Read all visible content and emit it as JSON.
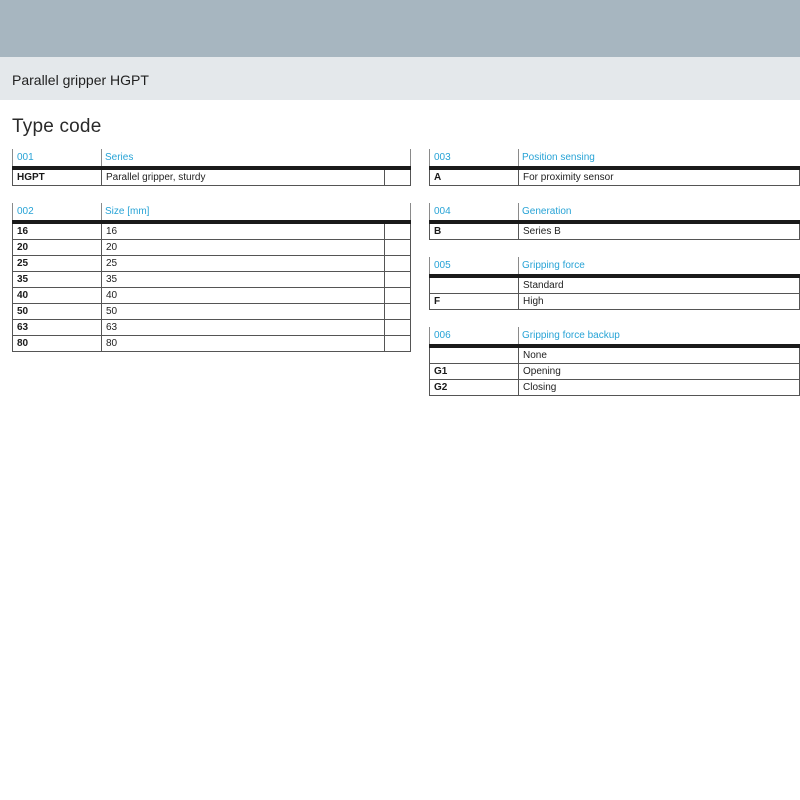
{
  "header": {
    "title": "Parallel gripper HGPT"
  },
  "page": {
    "heading": "Type code"
  },
  "tables": {
    "series": {
      "num": "001",
      "label": "Series",
      "rows": [
        {
          "code": "HGPT",
          "desc": "Parallel gripper, sturdy"
        }
      ]
    },
    "size": {
      "num": "002",
      "label": "Size [mm]",
      "rows": [
        {
          "code": "16",
          "desc": "16"
        },
        {
          "code": "20",
          "desc": "20"
        },
        {
          "code": "25",
          "desc": "25"
        },
        {
          "code": "35",
          "desc": "35"
        },
        {
          "code": "40",
          "desc": "40"
        },
        {
          "code": "50",
          "desc": "50"
        },
        {
          "code": "63",
          "desc": "63"
        },
        {
          "code": "80",
          "desc": "80"
        }
      ]
    },
    "position_sensing": {
      "num": "003",
      "label": "Position sensing",
      "rows": [
        {
          "code": "A",
          "desc": "For proximity sensor"
        }
      ]
    },
    "generation": {
      "num": "004",
      "label": "Generation",
      "rows": [
        {
          "code": "B",
          "desc": "Series B"
        }
      ]
    },
    "gripping_force": {
      "num": "005",
      "label": "Gripping force",
      "rows": [
        {
          "code": "",
          "desc": "Standard"
        },
        {
          "code": "F",
          "desc": "High"
        }
      ]
    },
    "gripping_force_backup": {
      "num": "006",
      "label": "Gripping force backup",
      "rows": [
        {
          "code": "",
          "desc": "None"
        },
        {
          "code": "G1",
          "desc": "Opening"
        },
        {
          "code": "G2",
          "desc": "Closing"
        }
      ]
    }
  },
  "colors": {
    "accent": "#27a3d6",
    "top_band": "#a7b6c0",
    "title_band": "#e4e8eb"
  }
}
